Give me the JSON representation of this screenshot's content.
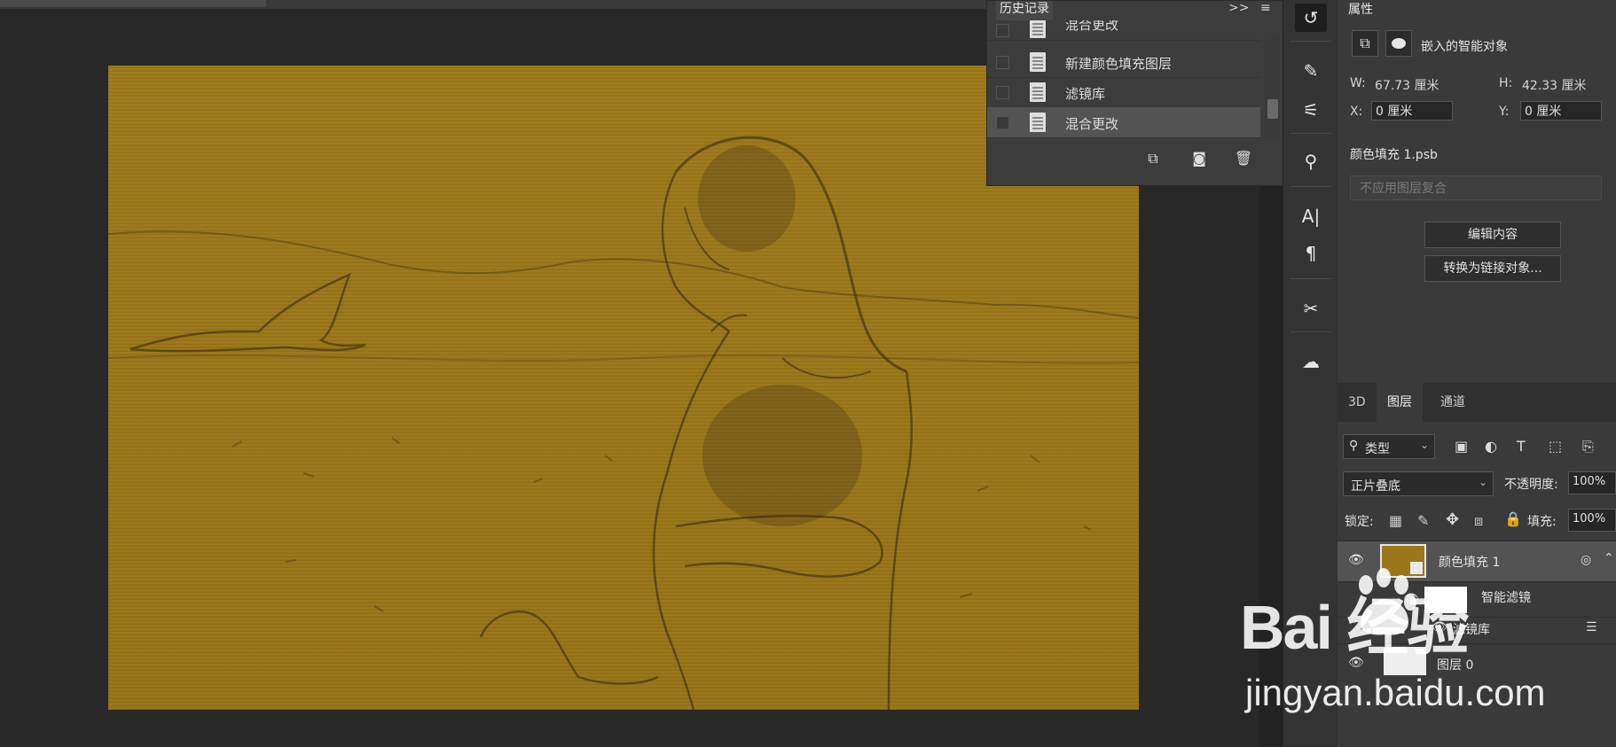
{
  "history": {
    "title": "历史记录",
    "expand_glyph": ">>",
    "menu_glyph": "≡",
    "items": [
      {
        "label": "混合更改",
        "selected": false
      },
      {
        "label": "新建颜色填充图层",
        "selected": false
      },
      {
        "label": "滤镜库",
        "selected": false
      },
      {
        "label": "混合更改",
        "selected": true
      }
    ]
  },
  "properties": {
    "title": "属性",
    "object_type": "嵌入的智能对象",
    "w_label": "W:",
    "w_value": "67.73 厘米",
    "h_label": "H:",
    "h_value": "42.33 厘米",
    "x_label": "X:",
    "x_value": "0 厘米",
    "y_label": "Y:",
    "y_value": "0 厘米",
    "file_name": "颜色填充 1.psb",
    "comp_dropdown": "不应用图层复合",
    "edit_button": "编辑内容",
    "convert_button": "转换为链接对象..."
  },
  "layers": {
    "tabs": [
      "3D",
      "图层",
      "通道"
    ],
    "active_tab": "图层",
    "filter_label": "类型",
    "blend_mode": "正片叠底",
    "opacity_label": "不透明度:",
    "opacity_value": "100%",
    "lock_label": "锁定:",
    "fill_label": "填充:",
    "fill_value": "100%",
    "rows": [
      {
        "name": "颜色填充 1",
        "selected": true
      },
      {
        "name": "智能滤镜",
        "selected": false
      },
      {
        "name": "滤镜库",
        "selected": false
      },
      {
        "name": "图层 0",
        "selected": false
      }
    ]
  },
  "tools": [
    "history-icon",
    "brush-settings-icon",
    "adjust-icon",
    "clone-source-icon",
    "character-icon",
    "paragraph-icon",
    "tool-presets-icon",
    "creative-cloud-icon"
  ],
  "watermark": {
    "brand": "Bai  经验",
    "url": "jingyan.baidu.com"
  },
  "colors": {
    "canvas_fill": "#9d781c",
    "panel_bg": "#3a3a3a",
    "workspace_bg": "#282828"
  }
}
